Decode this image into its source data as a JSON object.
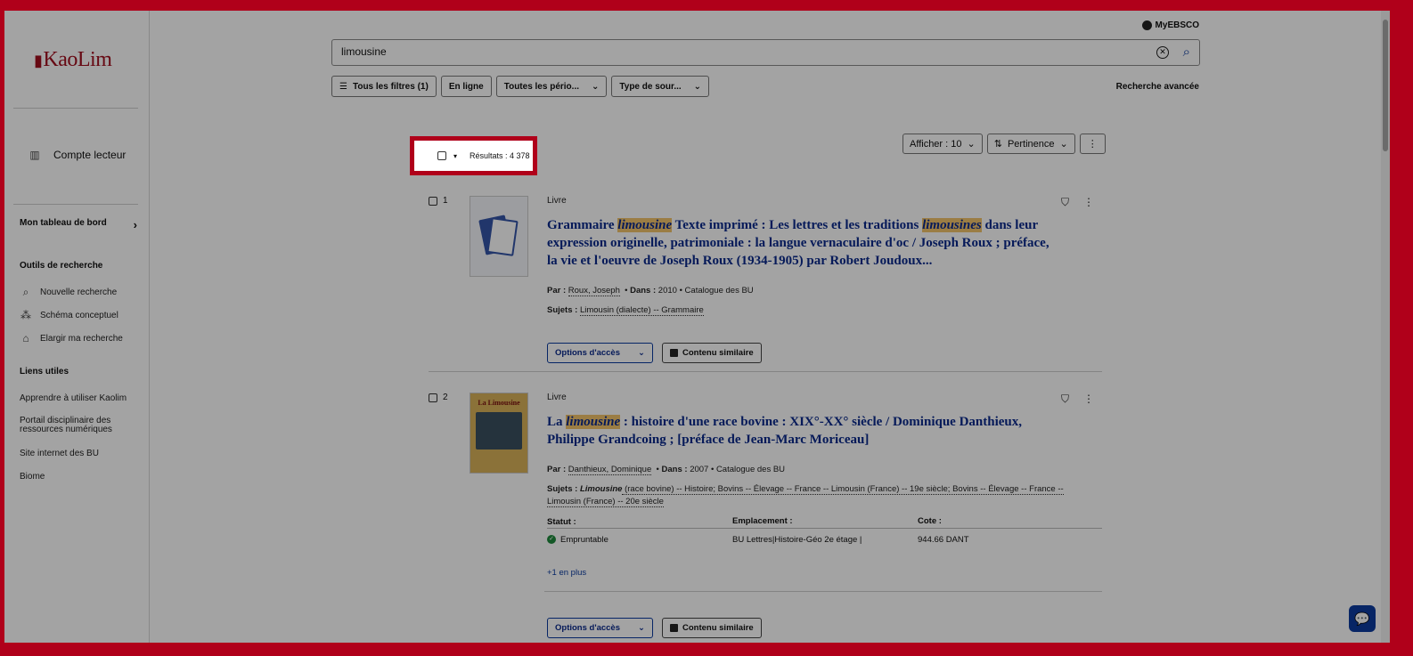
{
  "logo": {
    "text": "KaoLim"
  },
  "sidebar": {
    "account_label": "Compte lecteur",
    "dashboard_label": "Mon tableau de bord",
    "tools_heading": "Outils de recherche",
    "tools": [
      {
        "label": "Nouvelle recherche",
        "icon": "search-icon"
      },
      {
        "label": "Schéma conceptuel",
        "icon": "concept-map-icon"
      },
      {
        "label": "Elargir ma recherche",
        "icon": "library-icon"
      }
    ],
    "links_heading": "Liens utiles",
    "links": [
      {
        "label": "Apprendre à utiliser Kaolim"
      },
      {
        "label": "Portail disciplinaire des ressources numériques"
      },
      {
        "label": "Site internet des BU"
      },
      {
        "label": "Biome"
      }
    ]
  },
  "header": {
    "myebsco_label": "MyEBSCO",
    "search_value": "limousine",
    "filters": [
      {
        "label": "Tous les filtres (1)"
      },
      {
        "label": "En ligne"
      },
      {
        "label": "Toutes les pério..."
      },
      {
        "label": "Type de sour..."
      }
    ],
    "advanced_label": "Recherche avancée"
  },
  "results_bar": {
    "count_label": "Résultats : 4 378",
    "show_label": "Afficher : 10",
    "sort_label": "Pertinence"
  },
  "results": [
    {
      "number": "1",
      "type": "Livre",
      "title_parts": [
        "Grammaire ",
        "limousine",
        " Texte imprimé : Les lettres et les traditions ",
        "limousines",
        " dans leur expression originelle, patrimoniale : la langue vernaculaire d'oc / Joseph Roux ; préface, la vie et l'oeuvre de Joseph Roux (1934-1905) par Robert Joudoux..."
      ],
      "by_label": "Par :",
      "author": "Roux, Joseph",
      "in_label": "Dans :",
      "year": "2010",
      "source": "Catalogue des BU",
      "subjects_label": "Sujets :",
      "subjects": "Limousin (dialecte) -- Grammaire",
      "access_label": "Options d'accès",
      "similar_label": "Contenu similaire"
    },
    {
      "number": "2",
      "type": "Livre",
      "title_parts": [
        "La ",
        "limousine",
        " : histoire d'une race bovine : XIX°-XX° siècle / Dominique Danthieux, Philippe Grandcoing ; [préface de Jean-Marc Moriceau]"
      ],
      "by_label": "Par :",
      "author": "Danthieux, Dominique",
      "in_label": "Dans :",
      "year": "2007",
      "source": "Catalogue des BU",
      "subjects_label": "Sujets :",
      "subjects_hl": "Limousine",
      "subjects_rest": " (race bovine) -- Histoire; Bovins -- Élevage -- France -- Limousin (France) -- 19e siècle; Bovins -- Élevage -- France --",
      "subjects_line2": "Limousin (France) -- 20e siècle",
      "cover_title": "La Limousine",
      "status_head": "Statut :",
      "location_head": "Emplacement :",
      "call_head": "Cote :",
      "status": "Empruntable",
      "location": "BU Lettres|Histoire-Géo 2e étage |",
      "call": "944.66 DANT",
      "more_label": "+1 en plus",
      "access_label": "Options d'accès",
      "similar_label": "Contenu similaire"
    }
  ],
  "colors": {
    "accent": "#b0001a",
    "link": "#0a2a8c",
    "highlight": "#f2c46b"
  }
}
